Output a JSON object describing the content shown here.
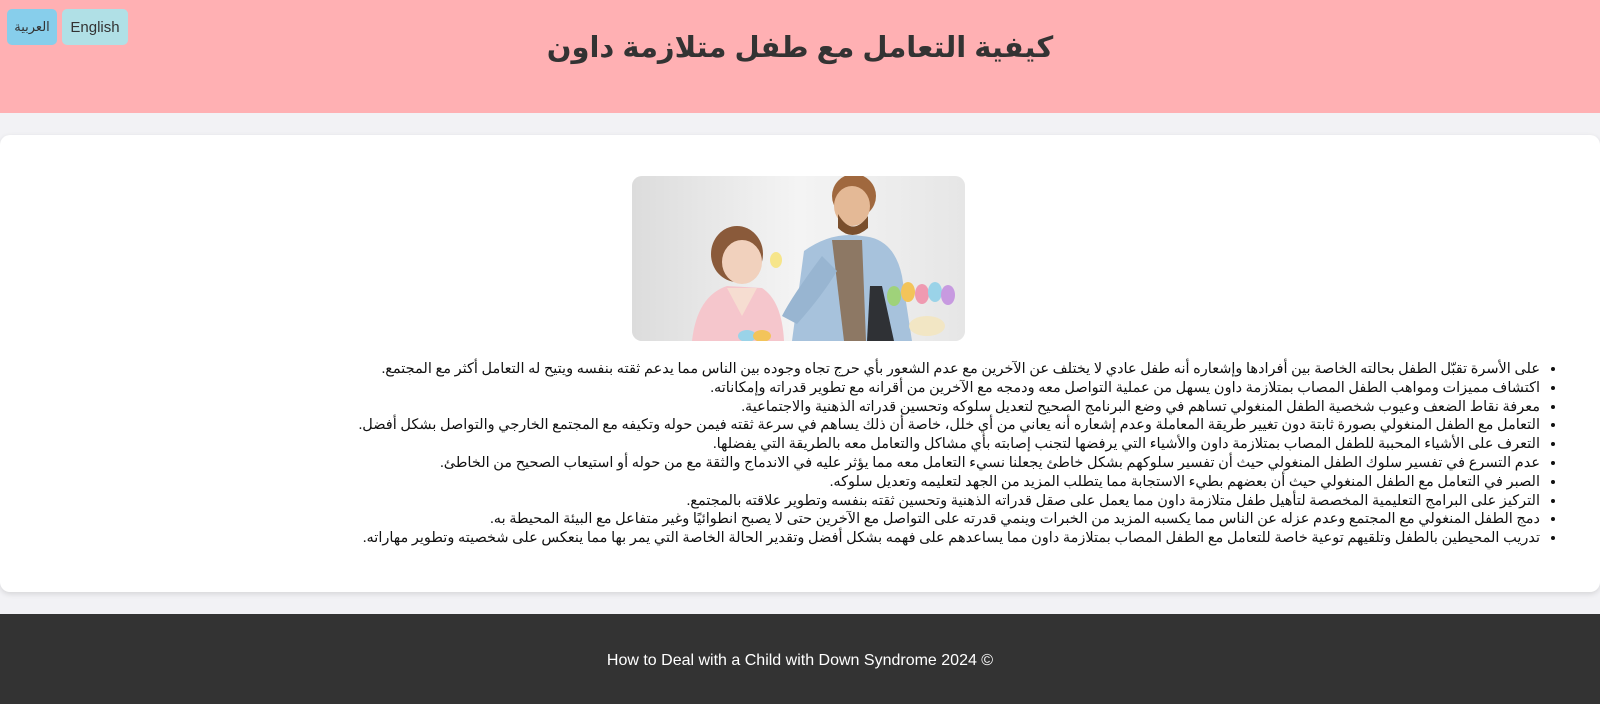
{
  "header": {
    "title": "كيفية التعامل مع طفل متلازمة داون",
    "lang_buttons": [
      {
        "label": "العربية"
      },
      {
        "label": "English"
      }
    ],
    "background": "#ffb0b3"
  },
  "main": {
    "image": {
      "alt": "hero-photo"
    },
    "tips": [
      "على الأسرة تقبّل الطفل بحالته الخاصة بين أفرادها وإشعاره أنه طفل عادي لا يختلف عن الآخرين مع عدم الشعور بأي حرج تجاه وجوده بين الناس مما يدعم ثقته بنفسه ويتيح له التعامل أكثر مع المجتمع.",
      "اكتشاف مميزات ومواهب الطفل المصاب بمتلازمة داون يسهل من عملية التواصل معه ودمجه مع الآخرين من أقرانه مع تطوير قدراته وإمكاناته.",
      "معرفة نقاط الضعف وعيوب شخصية الطفل المنغولي تساهم في وضع البرنامج الصحيح لتعديل سلوكه وتحسين قدراته الذهنية والاجتماعية.",
      "التعامل مع الطفل المنغولي بصورة ثابتة دون تغيير طريقة المعاملة وعدم إشعاره أنه يعاني من أي خلل، خاصة أن ذلك يساهم في سرعة ثقته فيمن حوله وتكيفه مع المجتمع الخارجي والتواصل بشكل أفضل.",
      "التعرف على الأشياء المحببة للطفل المصاب بمتلازمة داون والأشياء التي يرفضها لتجنب إصابته بأي مشاكل والتعامل معه بالطريقة التي يفضلها.",
      "عدم التسرع في تفسير سلوك الطفل المنغولي حيث أن تفسير سلوكهم بشكل خاطئ يجعلنا نسيء التعامل معه مما يؤثر عليه في الاندماج والثقة مع من حوله أو استيعاب الصحيح من الخاطئ.",
      "الصبر في التعامل مع الطفل المنغولي حيث أن بعضهم بطيء الاستجابة مما يتطلب المزيد من الجهد لتعليمه وتعديل سلوكه.",
      "التركيز على البرامج التعليمية المخصصة لتأهيل طفل متلازمة داون مما يعمل على صقل قدراته الذهنية وتحسين ثقته بنفسه وتطوير علاقته بالمجتمع.",
      "دمج الطفل المنغولي مع المجتمع وعدم عزله عن الناس مما يكسبه المزيد من الخبرات وينمي قدرته على التواصل مع الآخرين حتى لا يصبح انطوائيًا وغير متفاعل مع البيئة المحيطة به.",
      "تدريب المحيطين بالطفل وتلقيهم توعية خاصة للتعامل مع الطفل المصاب بمتلازمة داون مما يساعدهم على فهمه بشكل أفضل وتقدير الحالة الخاصة التي يمر بها مما ينعكس على شخصيته وتطوير مهاراته."
    ]
  },
  "footer": {
    "text": "How to Deal with a Child with Down Syndrome 2024 ©",
    "background": "#333333"
  }
}
